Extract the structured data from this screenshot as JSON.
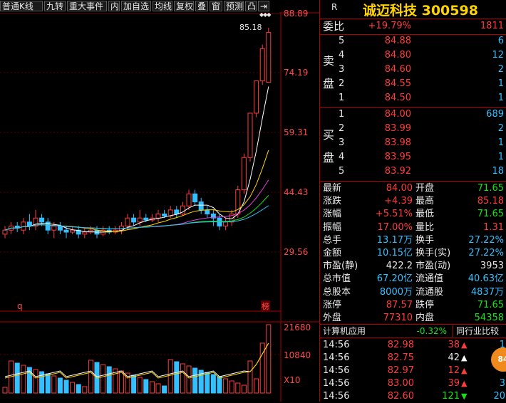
{
  "toolbar": {
    "items": [
      "普通K线",
      "九转",
      "重大事件",
      "内",
      "加自选",
      "均线",
      "复权",
      "叠",
      "窗",
      "预测",
      "凸",
      "⇥"
    ],
    "arrows": "◆◆◆"
  },
  "chart": {
    "y_labels": [
      "88.89",
      "74.19",
      "59.31",
      "44.43",
      "29.56"
    ],
    "peak_label": "85.18",
    "vol_labels": [
      "21680",
      "10840",
      "X10"
    ],
    "q_label": "q",
    "bang_label": "榜"
  },
  "header": {
    "market": "R",
    "title": "诚迈科技 300598"
  },
  "weibi": {
    "label": "委比",
    "value": "+19.79%",
    "diff": "1811"
  },
  "sell": {
    "side_label": [
      "卖",
      "盘"
    ],
    "rows": [
      {
        "n": "5",
        "price": "84.88",
        "vol": "6"
      },
      {
        "n": "4",
        "price": "84.80",
        "vol": "12"
      },
      {
        "n": "3",
        "price": "84.60",
        "vol": "2"
      },
      {
        "n": "2",
        "price": "84.55",
        "vol": "1"
      },
      {
        "n": "1",
        "price": "84.50",
        "vol": "1"
      }
    ]
  },
  "buy": {
    "side_label": [
      "买",
      "盘"
    ],
    "rows": [
      {
        "n": "1",
        "price": "84.00",
        "vol": "689"
      },
      {
        "n": "2",
        "price": "83.99",
        "vol": "2"
      },
      {
        "n": "3",
        "price": "83.98",
        "vol": "1"
      },
      {
        "n": "4",
        "price": "83.95",
        "vol": "1"
      },
      {
        "n": "5",
        "price": "83.92",
        "vol": "18"
      }
    ]
  },
  "stats": [
    {
      "l1": "最新",
      "v1": "84.00",
      "c1": "red",
      "l2": "开盘",
      "v2": "71.65",
      "c2": "green"
    },
    {
      "l1": "涨跌",
      "v1": "+4.39",
      "c1": "red",
      "l2": "最高",
      "v2": "85.18",
      "c2": "red"
    },
    {
      "l1": "涨幅",
      "v1": "+5.51%",
      "c1": "red",
      "l2": "最低",
      "v2": "71.65",
      "c2": "green"
    },
    {
      "l1": "振幅",
      "v1": "17.00%",
      "c1": "red",
      "l2": "量比",
      "v2": "1.31",
      "c2": "red"
    },
    {
      "l1": "总手",
      "v1": "13.17万",
      "c1": "cyan",
      "l2": "换手",
      "v2": "27.22%",
      "c2": "cyan"
    },
    {
      "l1": "金额",
      "v1": "10.15亿",
      "c1": "cyan",
      "l2": "换手(实)",
      "v2": "27.22%",
      "c2": "cyan"
    },
    {
      "l1": "市盈(静)",
      "v1": "422.2",
      "c1": "white",
      "l2": "市盈(动)",
      "v2": "3953",
      "c2": "white"
    },
    {
      "l1": "总市值",
      "v1": "67.20亿",
      "c1": "cyan",
      "l2": "流通值",
      "v2": "40.63亿",
      "c2": "cyan"
    },
    {
      "l1": "总股本",
      "v1": "8000万",
      "c1": "cyan",
      "l2": "流通股",
      "v2": "4837万",
      "c2": "cyan"
    },
    {
      "l1": "涨停",
      "v1": "87.57",
      "c1": "red",
      "l2": "跌停",
      "v2": "71.65",
      "c2": "green"
    },
    {
      "l1": "外盘",
      "v1": "77310",
      "c1": "red",
      "l2": "内盘",
      "v2": "54358",
      "c2": "green"
    }
  ],
  "industry": {
    "name": "计算机应用",
    "change": "-0.32%",
    "compare_button": "同行业比较"
  },
  "ticks": [
    {
      "time": "14:56",
      "price": "82.98",
      "vol": "38",
      "dir": "up",
      "extra": "1"
    },
    {
      "time": "14:56",
      "price": "82.75",
      "vol": "42",
      "dir": "up-white",
      "extra": "1"
    },
    {
      "time": "14:56",
      "price": "82.97",
      "vol": "12",
      "dir": "up",
      "extra": ""
    },
    {
      "time": "14:56",
      "price": "83.00",
      "vol": "39",
      "dir": "up",
      "extra": "3"
    },
    {
      "time": "14:56",
      "price": "82.60",
      "vol": "121",
      "dir": "down",
      "extra": "20"
    }
  ],
  "badge": "84",
  "colors": {
    "up": "#ff3c3c",
    "down": "#18e018",
    "accent": "#b00000",
    "blue": "#34c0ff",
    "gold": "#ffd400"
  }
}
